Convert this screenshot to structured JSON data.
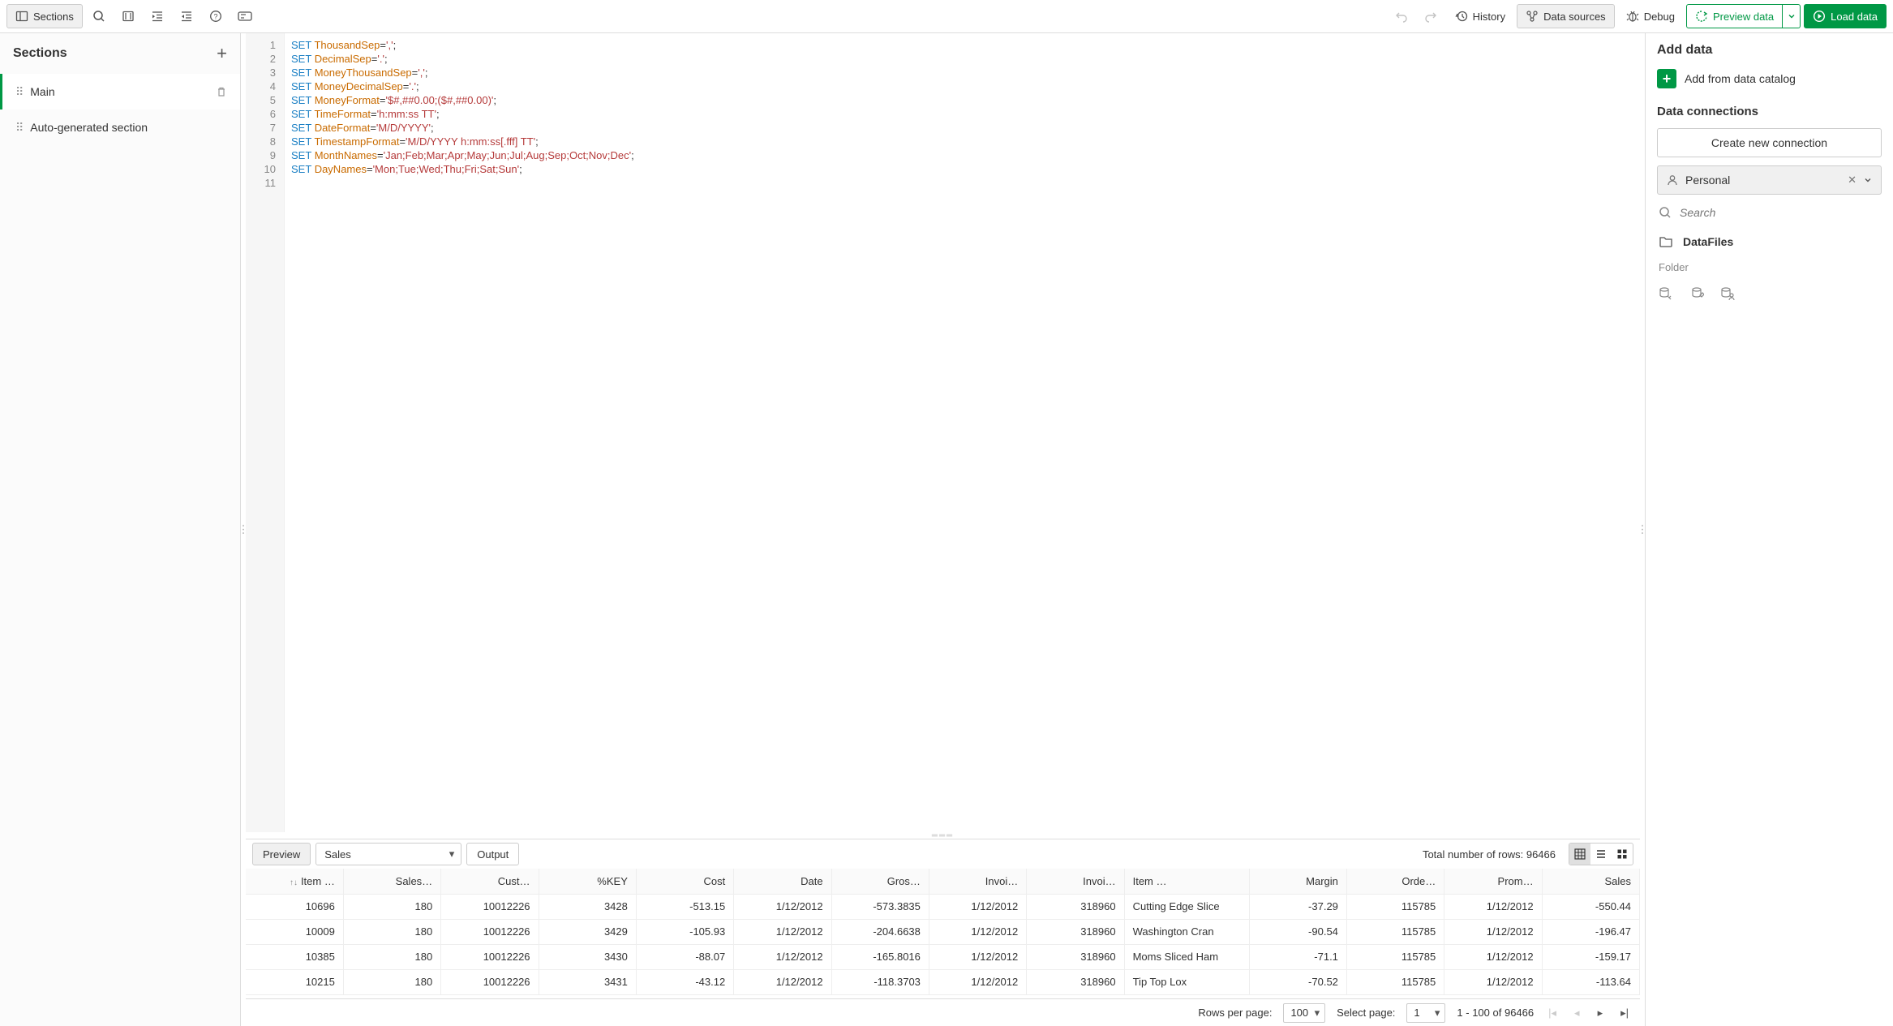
{
  "toolbar": {
    "sections_label": "Sections",
    "history_label": "History",
    "datasources_label": "Data sources",
    "debug_label": "Debug",
    "preview_label": "Preview data",
    "load_label": "Load data"
  },
  "sections": {
    "title": "Sections",
    "items": [
      {
        "label": "Main",
        "active": true,
        "deletable": true
      },
      {
        "label": "Auto-generated section",
        "active": false,
        "deletable": false
      }
    ]
  },
  "editor": {
    "lines": [
      {
        "n": 1,
        "kw": "SET",
        "var": "ThousandSep",
        "val": "','"
      },
      {
        "n": 2,
        "kw": "SET",
        "var": "DecimalSep",
        "val": "'.'"
      },
      {
        "n": 3,
        "kw": "SET",
        "var": "MoneyThousandSep",
        "val": "','"
      },
      {
        "n": 4,
        "kw": "SET",
        "var": "MoneyDecimalSep",
        "val": "'.'"
      },
      {
        "n": 5,
        "kw": "SET",
        "var": "MoneyFormat",
        "val": "'$#,##0.00;($#,##0.00)'"
      },
      {
        "n": 6,
        "kw": "SET",
        "var": "TimeFormat",
        "val": "'h:mm:ss TT'"
      },
      {
        "n": 7,
        "kw": "SET",
        "var": "DateFormat",
        "val": "'M/D/YYYY'"
      },
      {
        "n": 8,
        "kw": "SET",
        "var": "TimestampFormat",
        "val": "'M/D/YYYY h:mm:ss[.fff] TT'"
      },
      {
        "n": 9,
        "kw": "SET",
        "var": "MonthNames",
        "val": "'Jan;Feb;Mar;Apr;May;Jun;Jul;Aug;Sep;Oct;Nov;Dec'"
      },
      {
        "n": 10,
        "kw": "SET",
        "var": "DayNames",
        "val": "'Mon;Tue;Wed;Thu;Fri;Sat;Sun'"
      },
      {
        "n": 11,
        "kw": "",
        "var": "",
        "val": ""
      }
    ]
  },
  "rightPanel": {
    "add_title": "Add data",
    "add_catalog": "Add from data catalog",
    "conn_title": "Data connections",
    "create_conn": "Create new connection",
    "space_label": "Personal",
    "search_placeholder": "Search",
    "folder_name": "DataFiles",
    "folder_sub": "Folder"
  },
  "preview": {
    "tab_preview": "Preview",
    "tab_output": "Output",
    "table_select": "Sales",
    "total_label": "Total number of rows: 96466",
    "columns": [
      "Item …",
      "Sales…",
      "Cust…",
      "%KEY",
      "Cost",
      "Date",
      "Gros…",
      "Invoi…",
      "Invoi…",
      "Item …",
      "Margin",
      "Orde…",
      "Prom…",
      "Sales"
    ],
    "rows": [
      [
        "10696",
        "180",
        "10012226",
        "3428",
        "-513.15",
        "1/12/2012",
        "-573.3835",
        "1/12/2012",
        "318960",
        "Cutting Edge Slice",
        "-37.29",
        "115785",
        "1/12/2012",
        "-550.44"
      ],
      [
        "10009",
        "180",
        "10012226",
        "3429",
        "-105.93",
        "1/12/2012",
        "-204.6638",
        "1/12/2012",
        "318960",
        "Washington Cran",
        "-90.54",
        "115785",
        "1/12/2012",
        "-196.47"
      ],
      [
        "10385",
        "180",
        "10012226",
        "3430",
        "-88.07",
        "1/12/2012",
        "-165.8016",
        "1/12/2012",
        "318960",
        "Moms Sliced Ham",
        "-71.1",
        "115785",
        "1/12/2012",
        "-159.17"
      ],
      [
        "10215",
        "180",
        "10012226",
        "3431",
        "-43.12",
        "1/12/2012",
        "-118.3703",
        "1/12/2012",
        "318960",
        "Tip Top Lox",
        "-70.52",
        "115785",
        "1/12/2012",
        "-113.64"
      ]
    ],
    "item_desc_col_index": 9
  },
  "pager": {
    "rows_per_page_label": "Rows per page:",
    "rows_per_page_value": "100",
    "select_page_label": "Select page:",
    "select_page_value": "1",
    "range_label": "1 - 100 of 96466"
  }
}
